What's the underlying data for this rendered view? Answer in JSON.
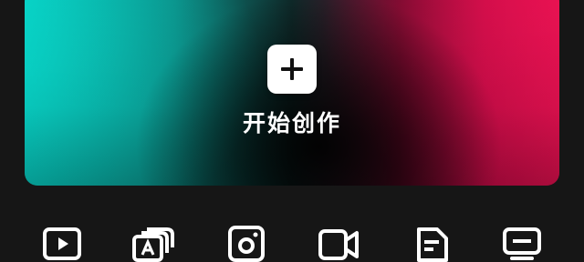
{
  "hero": {
    "label": "开始创作",
    "icon": "plus-icon",
    "colors": {
      "teal": "#07cbc0",
      "crimson": "#e20f4f",
      "center": "#0a0a0a"
    }
  },
  "tools": [
    {
      "icon": "play-video-icon"
    },
    {
      "icon": "text-layers-icon"
    },
    {
      "icon": "photo-frame-icon"
    },
    {
      "icon": "video-camera-icon"
    },
    {
      "icon": "document-icon"
    },
    {
      "icon": "monitor-icon"
    }
  ],
  "colors": {
    "background": "#161616",
    "icon_stroke": "#ffffff"
  }
}
